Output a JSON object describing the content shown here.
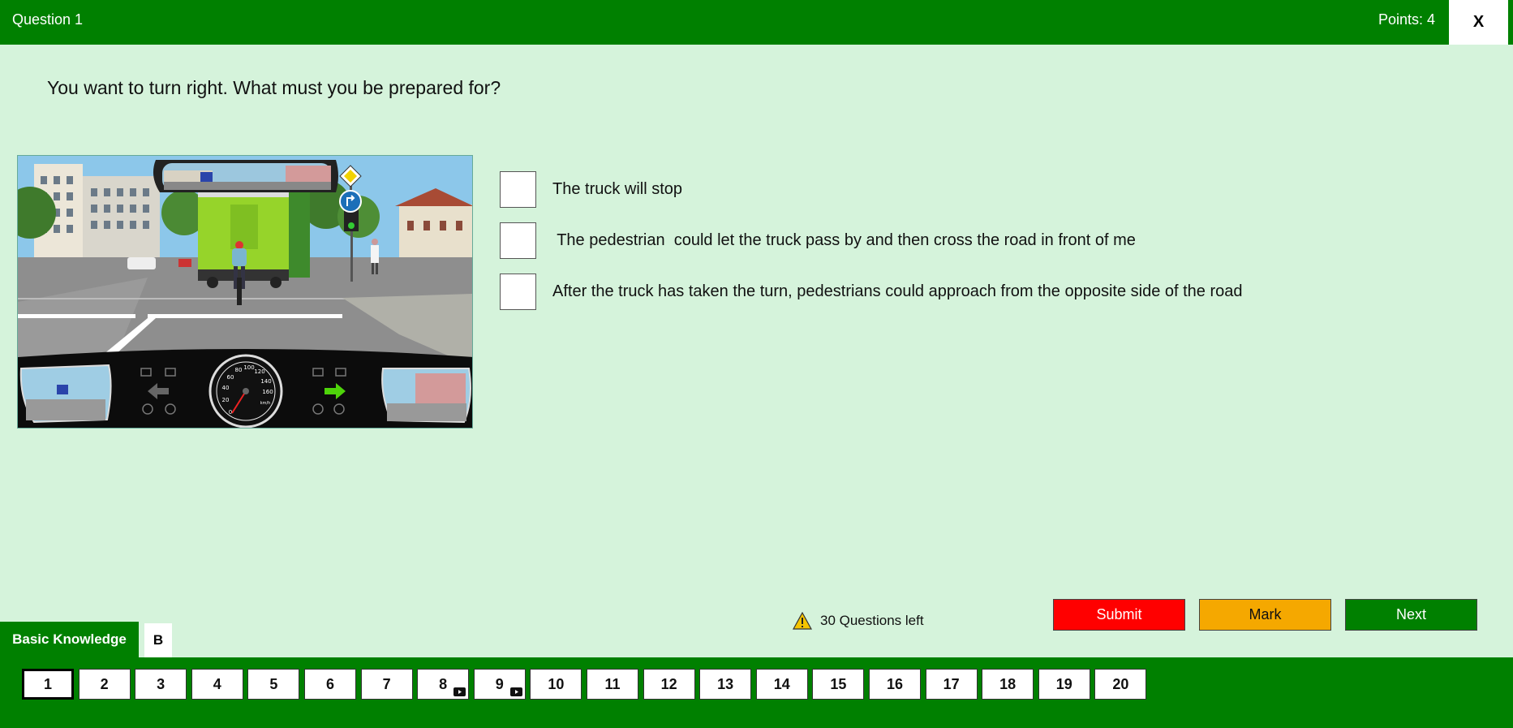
{
  "header": {
    "question_label": "Question 1",
    "points": "Points: 4",
    "close_label": "X"
  },
  "question": {
    "text": "You want to turn right. What must you be prepared for?",
    "answers": [
      {
        "text": "The truck will stop",
        "checked": false
      },
      {
        "text": " The pedestrian  could let the truck pass by and then cross the road in front of me",
        "checked": false
      },
      {
        "text": "After the truck has taken the turn, pedestrians could approach from the opposite side of the road",
        "checked": false
      }
    ]
  },
  "status": {
    "icon": "warning-icon",
    "text": "30 Questions left"
  },
  "actions": {
    "submit": "Submit",
    "mark": "Mark",
    "next": "Next"
  },
  "categories": {
    "basic": "Basic Knowledge",
    "b": "B"
  },
  "numbers": [
    "1",
    "2",
    "3",
    "4",
    "5",
    "6",
    "7",
    "8",
    "9",
    "10",
    "11",
    "12",
    "13",
    "14",
    "15",
    "16",
    "17",
    "18",
    "19",
    "20"
  ],
  "active_number": "1",
  "video_questions": [
    "8",
    "9"
  ],
  "scene": {
    "speedo_labels": [
      "0",
      "20",
      "40",
      "60",
      "80",
      "100",
      "120",
      "140",
      "160"
    ],
    "speedo_unit": "km/h"
  },
  "colors": {
    "header_green": "#008000",
    "background": "#d5f3db",
    "submit_red": "#ff0000",
    "mark_orange": "#f5a800"
  }
}
